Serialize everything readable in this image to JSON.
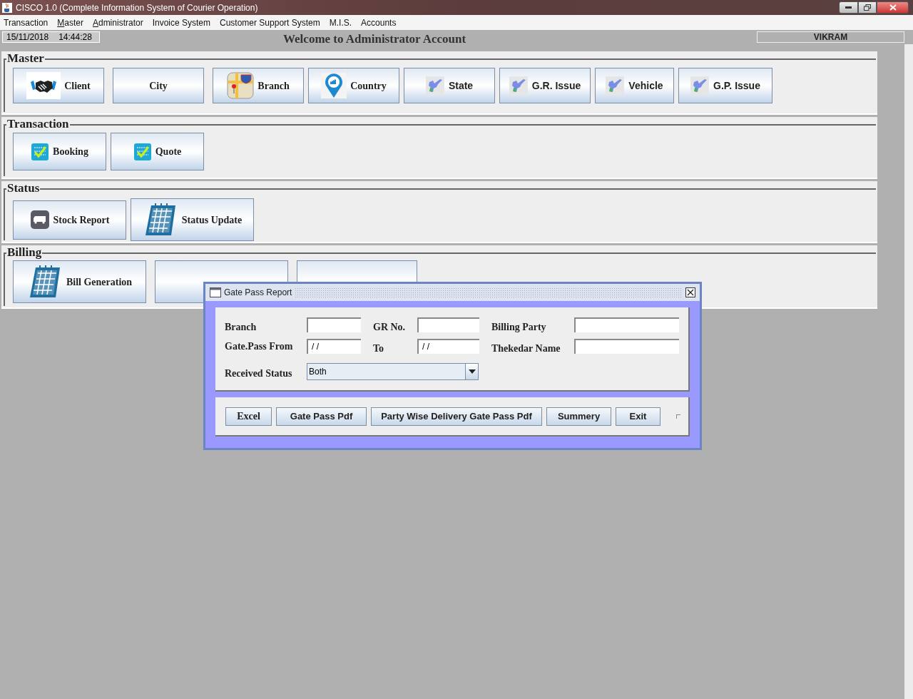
{
  "window": {
    "title": "CISCO 1.0 (Complete Information System of Courier Operation)"
  },
  "menu": [
    {
      "label": "Transaction",
      "mnemonic": false
    },
    {
      "label": "Master",
      "mnemonic": true
    },
    {
      "label": "Administrator",
      "mnemonic": true
    },
    {
      "label": "Invoice System",
      "mnemonic": false
    },
    {
      "label": "Customer Support System",
      "mnemonic": false
    },
    {
      "label": "M.I.S.",
      "mnemonic": false
    },
    {
      "label": "Accounts",
      "mnemonic": false
    }
  ],
  "status_bar": {
    "date": "15/11/2018",
    "time": "14:44:28",
    "welcome": "Welcome to Administrator Account",
    "user": "VIKRAM"
  },
  "sections": [
    {
      "title": "Master",
      "buttons": [
        {
          "label": "Client",
          "kind": "handshake"
        },
        {
          "label": "City",
          "kind": "none"
        },
        {
          "label": "Branch",
          "kind": "map"
        },
        {
          "label": "Country",
          "kind": "pin"
        },
        {
          "label": "State",
          "kind": "region"
        },
        {
          "label": "G.R. Issue",
          "kind": "region"
        },
        {
          "label": "Vehicle",
          "kind": "region"
        },
        {
          "label": "G.P. Issue",
          "kind": "region"
        }
      ]
    },
    {
      "title": "Transaction",
      "buttons": [
        {
          "label": "Booking",
          "kind": "checklist"
        },
        {
          "label": "Quote",
          "kind": "checklist"
        }
      ]
    },
    {
      "title": "Status",
      "buttons": [
        {
          "label": "Stock Report",
          "kind": "truck"
        },
        {
          "label": "Status Update",
          "kind": "calendar"
        }
      ]
    },
    {
      "title": "Billing",
      "buttons": [
        {
          "label": "Bill Generation",
          "kind": "calendar"
        },
        {
          "kind": "none"
        },
        {
          "kind": "none"
        }
      ]
    }
  ],
  "dialog": {
    "title": "Gate Pass Report",
    "fields": [
      {
        "label": "Branch"
      },
      {
        "label": "GR No."
      },
      {
        "label": "Billing Party"
      },
      {
        "label": "Gate.Pass From",
        "value": "/ /"
      },
      {
        "label": "To",
        "value": "/ /"
      },
      {
        "label": "Thekedar Name"
      }
    ],
    "received_status": {
      "label": "Received Status",
      "value": "Both"
    },
    "buttons": [
      "Excel",
      "Gate Pass Pdf",
      "Party Wise Delivery Gate Pass Pdf",
      "Summery",
      "Exit"
    ]
  }
}
